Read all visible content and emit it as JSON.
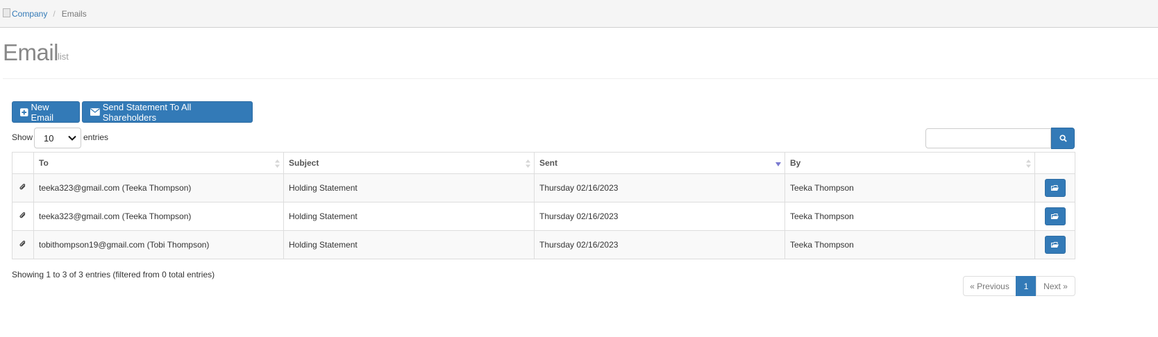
{
  "breadcrumb": {
    "items": [
      {
        "label": "Company",
        "link": true
      },
      {
        "label": "Emails",
        "link": false
      }
    ],
    "separator": "/"
  },
  "header": {
    "title": "Email",
    "subtitle": "list"
  },
  "toolbar": {
    "new_email_label": "New Email",
    "send_statement_label": "Send Statement To All Shareholders"
  },
  "length_control": {
    "show_label": "Show",
    "selected": "10",
    "entries_label": "entries"
  },
  "search": {
    "value": "",
    "placeholder": ""
  },
  "table": {
    "columns": [
      "To",
      "Subject",
      "Sent",
      "By"
    ],
    "sorted_column": "Sent",
    "sort_direction": "desc",
    "rows": [
      {
        "to": "teeka323@gmail.com (Teeka Thompson)",
        "subject": "Holding Statement",
        "sent": "Thursday 02/16/2023",
        "by": "Teeka Thompson"
      },
      {
        "to": "teeka323@gmail.com (Teeka Thompson)",
        "subject": "Holding Statement",
        "sent": "Thursday 02/16/2023",
        "by": "Teeka Thompson"
      },
      {
        "to": "tobithompson19@gmail.com (Tobi Thompson)",
        "subject": "Holding Statement",
        "sent": "Thursday 02/16/2023",
        "by": "Teeka Thompson"
      }
    ]
  },
  "info": "Showing 1 to 3 of 3 entries (filtered from 0 total entries)",
  "pagination": {
    "previous_label": "« Previous",
    "current_page": "1",
    "next_label": "Next »"
  },
  "icons": {
    "breadcrumb": "building-icon",
    "new_email": "plus-square-icon",
    "send_statement": "envelope-icon",
    "search": "search-icon",
    "attachment": "paperclip-icon",
    "open": "folder-open-icon"
  },
  "colors": {
    "primary": "#337ab7",
    "link": "#337ab7",
    "sort_active": "#7a7ad0"
  }
}
